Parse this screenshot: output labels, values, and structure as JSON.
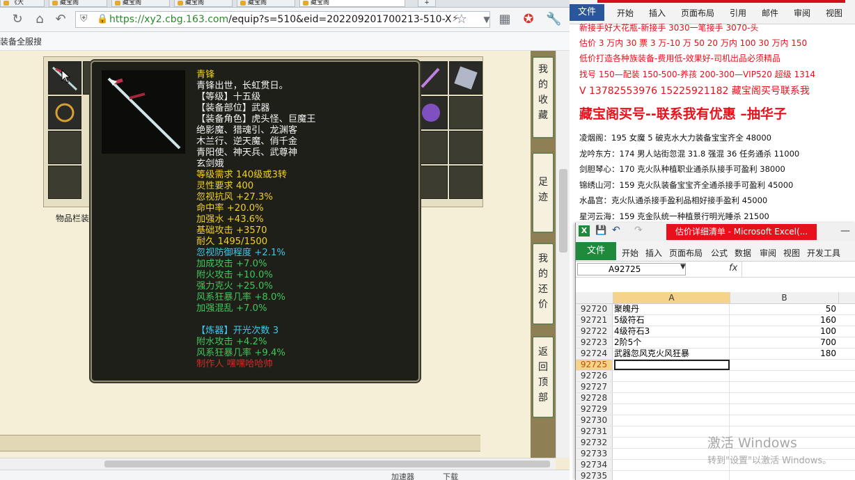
{
  "browser": {
    "tabs": [
      {
        "label": "《大"
      },
      {
        "label": "藏宝阁"
      },
      {
        "label": "藏宝阁"
      },
      {
        "label": "藏宝阁"
      },
      {
        "label": "藏宝阁"
      },
      {
        "label": "藏宝阁"
      }
    ],
    "new_tab_label": "+",
    "url_host": "https://xy2.cbg.163.com",
    "url_path": "/equip?s=510&eid=202209201700213-510-X",
    "bookmark_label": "装备全服搜",
    "inventory_label": "物品栏装",
    "status": {
      "accelerator": "加速器",
      "download": "下载"
    }
  },
  "sidebar": {
    "buttons": [
      {
        "label": "我的收藏"
      },
      {
        "label": "足迹"
      },
      {
        "label": "我的还价"
      },
      {
        "label": "返回顶部"
      }
    ]
  },
  "tooltip": {
    "lines": [
      {
        "text": "青锋",
        "color": "#f0d020"
      },
      {
        "text": "青锋出世，长虹贯日。",
        "color": "#f2f2f2"
      },
      {
        "text": "【等级】十五级",
        "color": "#f2f2f2"
      },
      {
        "text": "【装备部位】武器",
        "color": "#f2f2f2"
      },
      {
        "text": "【装备角色】虎头怪、巨魔王",
        "color": "#f2f2f2"
      },
      {
        "text": "绝影魔、猎魂引、龙渊客",
        "color": "#f2f2f2"
      },
      {
        "text": "木兰行、逆天魔、俏千金",
        "color": "#f2f2f2"
      },
      {
        "text": "青阳使、神天兵、武尊神",
        "color": "#f2f2f2"
      },
      {
        "text": "玄剑娥",
        "color": "#f2f2f2"
      },
      {
        "text": "等级需求 140级或3转",
        "color": "#f0d020"
      },
      {
        "text": "灵性要求 400",
        "color": "#f0d020"
      },
      {
        "text": "忽视抗风 +27.3%",
        "color": "#f0d020"
      },
      {
        "text": "命中率 +20.0%",
        "color": "#f0d020"
      },
      {
        "text": "加强水 +43.6%",
        "color": "#f0d020"
      },
      {
        "text": "基础攻击 +3570",
        "color": "#f0d020"
      },
      {
        "text": "耐久 1495/1500",
        "color": "#f0d020"
      },
      {
        "text": "忽视防御程度 +2.1%",
        "color": "#3cc8e8"
      },
      {
        "text": "加成攻击 +7.0%",
        "color": "#3cc858"
      },
      {
        "text": "附火攻击 +10.0%",
        "color": "#3cc858"
      },
      {
        "text": "强力克火 +25.0%",
        "color": "#3cc858"
      },
      {
        "text": "风系狂暴几率 +8.0%",
        "color": "#3cc858"
      },
      {
        "text": "加强混乱 +7.0%",
        "color": "#3cc858"
      },
      {
        "text": "",
        "color": "#f2f2f2"
      },
      {
        "text": "【炼器】开光次数 3",
        "color": "#3cc8e8"
      },
      {
        "text": "附水攻击 +4.2%",
        "color": "#3cc858"
      },
      {
        "text": "风系狂暴几率 +9.4%",
        "color": "#3cc858"
      },
      {
        "text": "制作人 嘿嘿哈哈帅",
        "color": "#c83028"
      }
    ]
  },
  "word": {
    "file_label": "文件",
    "tabs": [
      "开始",
      "插入",
      "页面布局",
      "引用",
      "邮件",
      "审阅",
      "视图"
    ],
    "lines": [
      {
        "text": "新接手好大花瓶-新接手 3030一笔接手 3070-头",
        "color": "#e8101a",
        "size": 12
      },
      {
        "text": "估价 3 万内 30 票  3 万-10 万 50 20 万内 100 30 万内 150",
        "color": "#e8101a",
        "size": 12
      },
      {
        "text": "低价打造各种族装备-费用低-效果好-司机出品必须精品",
        "color": "#e8101a",
        "size": 12
      },
      {
        "text": "找号 150—配装 150-500-养孩 200-300—VIP520 超级 1314",
        "color": "#e8101a",
        "size": 12
      },
      {
        "text": "V 13782553976    15225921182  藏宝阁买号联系我",
        "color": "#e8101a",
        "size": 14
      },
      {
        "text": "藏宝阁买号--联系我有优惠 –抽华子",
        "color": "#e8101a",
        "size": 19
      },
      {
        "text": "凌烟阁：195 女魔 5 破克水大力装备宝宝齐全 48000",
        "color": "#111111",
        "size": 11.5
      },
      {
        "text": "龙吟东方：174 男人站街忽混 31.8 强混 36 任务通杀 11000",
        "color": "#111111",
        "size": 11.5
      },
      {
        "text": "剑胆琴心：170 克火队种植职业通杀队接手可盈利 38000",
        "color": "#111111",
        "size": 11.5
      },
      {
        "text": "锦绣山河：159 克火队装备宝宝齐全通杀接手可盈利 45000",
        "color": "#111111",
        "size": 11.5
      },
      {
        "text": "水晶宫：克火队通杀接手盈利品相好接手盈利 45000",
        "color": "#111111",
        "size": 11.5
      },
      {
        "text": "星河云海：159 克金队统一种植景行明光睡杀 21500",
        "color": "#111111",
        "size": 11.5
      }
    ]
  },
  "excel": {
    "window_title": "估价详细清单 - Microsoft Excel(...",
    "file_label": "文件",
    "tabs": [
      "开始",
      "插入",
      "页面布局",
      "公式",
      "数据",
      "审阅",
      "视图",
      "开发工具"
    ],
    "name_box": "A92725",
    "fx_label": "fx",
    "columns": [
      "A",
      "B"
    ],
    "rows": [
      {
        "num": "92720",
        "a": "聚魄丹",
        "b": "50"
      },
      {
        "num": "92721",
        "a": "5级符石",
        "b": "160"
      },
      {
        "num": "92722",
        "a": "4级符石3",
        "b": "100"
      },
      {
        "num": "92723",
        "a": "2阶5个",
        "b": "700"
      },
      {
        "num": "92724",
        "a": "武器忽风克火风狂暴",
        "b": "180"
      },
      {
        "num": "92725",
        "a": "",
        "b": ""
      },
      {
        "num": "92726",
        "a": "",
        "b": ""
      },
      {
        "num": "92727",
        "a": "",
        "b": ""
      },
      {
        "num": "92728",
        "a": "",
        "b": ""
      },
      {
        "num": "92729",
        "a": "",
        "b": ""
      },
      {
        "num": "92730",
        "a": "",
        "b": ""
      },
      {
        "num": "92731",
        "a": "",
        "b": ""
      },
      {
        "num": "92732",
        "a": "",
        "b": ""
      },
      {
        "num": "92733",
        "a": "",
        "b": ""
      },
      {
        "num": "92734",
        "a": "",
        "b": ""
      },
      {
        "num": "92735",
        "a": "",
        "b": ""
      }
    ]
  },
  "watermark": {
    "line1": "激活 Windows",
    "line2": "转到\"设置\"以激活 Windows。"
  }
}
